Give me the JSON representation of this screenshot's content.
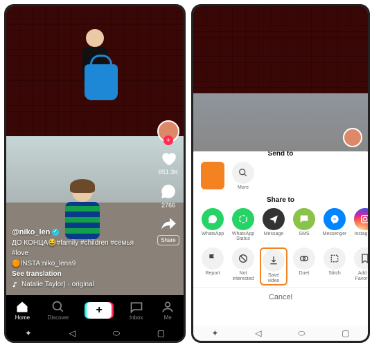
{
  "left": {
    "username": "@niko_len",
    "caption": "ДО КОНЦА😂#family #children #семья #love",
    "insta": "🟠INSTA:niko_lena9",
    "see_translation": "See translation",
    "music": "Natalie Taylor) · original",
    "likes": "651.3K",
    "comments": "2766",
    "share_label": "Share",
    "nav": {
      "home": "Home",
      "discover": "Discover",
      "inbox": "Inbox",
      "me": "Me"
    }
  },
  "right": {
    "send_to": "Send to",
    "more": "More",
    "share_to": "Share to",
    "share_targets": [
      {
        "id": "whatsapp",
        "label": "WhatsApp"
      },
      {
        "id": "whatsapp-status",
        "label": "WhatsApp Status"
      },
      {
        "id": "message",
        "label": "Message"
      },
      {
        "id": "sms",
        "label": "SMS"
      },
      {
        "id": "messenger",
        "label": "Messenger"
      },
      {
        "id": "instagram",
        "label": "Instagram"
      }
    ],
    "actions": [
      {
        "id": "report",
        "label": "Report"
      },
      {
        "id": "not-interested",
        "label": "Not interested"
      },
      {
        "id": "save-video",
        "label": "Save video"
      },
      {
        "id": "duet",
        "label": "Duet"
      },
      {
        "id": "stitch",
        "label": "Stitch"
      },
      {
        "id": "add-favorites",
        "label": "Add to Favorites"
      }
    ],
    "cancel": "Cancel"
  }
}
